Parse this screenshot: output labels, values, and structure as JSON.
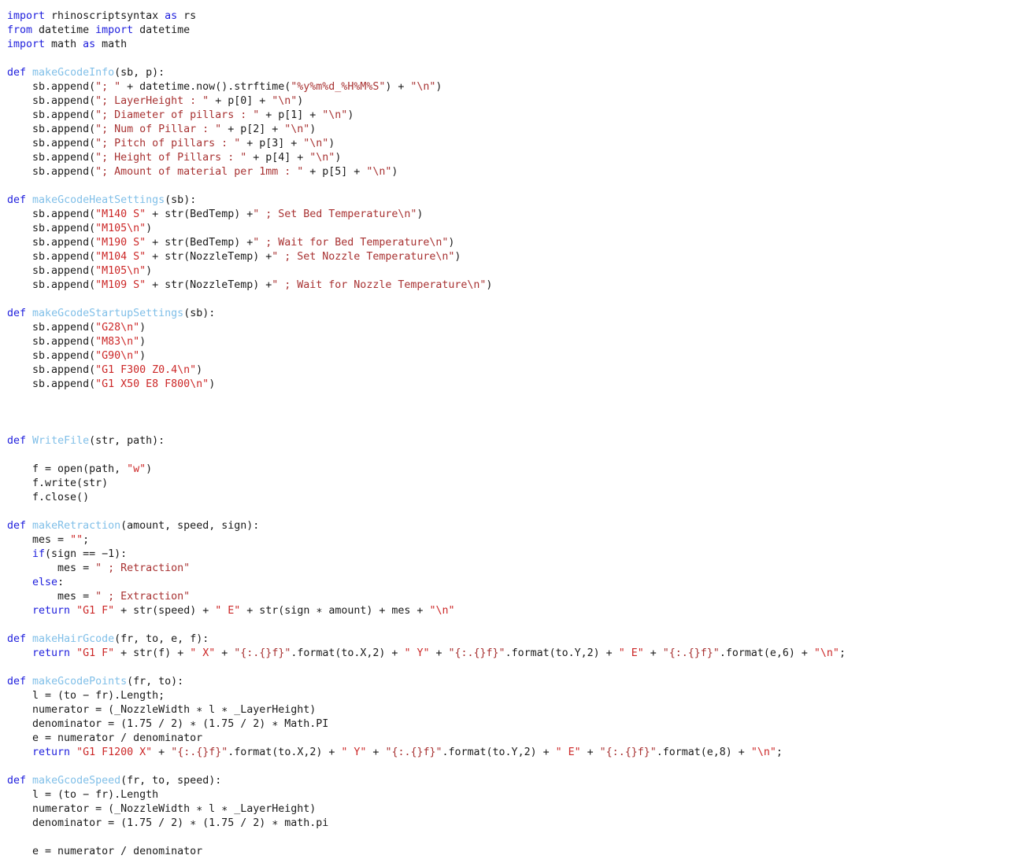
{
  "editor": {
    "language": "python",
    "background_color": "#ffffff",
    "colors": {
      "keyword": "#2020dd",
      "function_name": "#80bfe8",
      "string": "#a83232",
      "string_bright": "#cc2727",
      "plain_text": "#1a1a1a"
    }
  },
  "code": {
    "lines": [
      {
        "n": 1,
        "tokens": [
          {
            "t": "import",
            "c": "kw"
          },
          {
            "t": " rhinoscriptsyntax ",
            "c": "plain"
          },
          {
            "t": "as",
            "c": "kw"
          },
          {
            "t": " rs",
            "c": "plain"
          }
        ]
      },
      {
        "n": 2,
        "tokens": [
          {
            "t": "from",
            "c": "kw"
          },
          {
            "t": " datetime ",
            "c": "plain"
          },
          {
            "t": "import",
            "c": "kw"
          },
          {
            "t": " datetime",
            "c": "plain"
          }
        ]
      },
      {
        "n": 3,
        "tokens": [
          {
            "t": "import",
            "c": "kw"
          },
          {
            "t": " math ",
            "c": "plain"
          },
          {
            "t": "as",
            "c": "kw"
          },
          {
            "t": " math",
            "c": "plain"
          }
        ]
      },
      {
        "n": 4,
        "tokens": []
      },
      {
        "n": 5,
        "tokens": [
          {
            "t": "def",
            "c": "kw"
          },
          {
            "t": " ",
            "c": "plain"
          },
          {
            "t": "makeGcodeInfo",
            "c": "fn"
          },
          {
            "t": "(sb, p):",
            "c": "plain"
          }
        ]
      },
      {
        "n": 6,
        "tokens": [
          {
            "t": "    sb.append(",
            "c": "plain"
          },
          {
            "t": "\"; \"",
            "c": "str"
          },
          {
            "t": " + datetime.now().strftime(",
            "c": "plain"
          },
          {
            "t": "\"%y%m%d_%H%M%S\"",
            "c": "str"
          },
          {
            "t": ") + ",
            "c": "plain"
          },
          {
            "t": "\"\\n\"",
            "c": "str"
          },
          {
            "t": ")",
            "c": "plain"
          }
        ]
      },
      {
        "n": 7,
        "tokens": [
          {
            "t": "    sb.append(",
            "c": "plain"
          },
          {
            "t": "\"; LayerHeight : \"",
            "c": "str"
          },
          {
            "t": " + p[0] + ",
            "c": "plain"
          },
          {
            "t": "\"\\n\"",
            "c": "str"
          },
          {
            "t": ")",
            "c": "plain"
          }
        ]
      },
      {
        "n": 8,
        "tokens": [
          {
            "t": "    sb.append(",
            "c": "plain"
          },
          {
            "t": "\"; Diameter of pillars : \"",
            "c": "str"
          },
          {
            "t": " + p[1] + ",
            "c": "plain"
          },
          {
            "t": "\"\\n\"",
            "c": "str"
          },
          {
            "t": ")",
            "c": "plain"
          }
        ]
      },
      {
        "n": 9,
        "tokens": [
          {
            "t": "    sb.append(",
            "c": "plain"
          },
          {
            "t": "\"; Num of Pillar : \"",
            "c": "str"
          },
          {
            "t": " + p[2] + ",
            "c": "plain"
          },
          {
            "t": "\"\\n\"",
            "c": "str"
          },
          {
            "t": ")",
            "c": "plain"
          }
        ]
      },
      {
        "n": 10,
        "tokens": [
          {
            "t": "    sb.append(",
            "c": "plain"
          },
          {
            "t": "\"; Pitch of pillars : \"",
            "c": "str"
          },
          {
            "t": " + p[3] + ",
            "c": "plain"
          },
          {
            "t": "\"\\n\"",
            "c": "str"
          },
          {
            "t": ")",
            "c": "plain"
          }
        ]
      },
      {
        "n": 11,
        "tokens": [
          {
            "t": "    sb.append(",
            "c": "plain"
          },
          {
            "t": "\"; Height of Pillars : \"",
            "c": "str"
          },
          {
            "t": " + p[4] + ",
            "c": "plain"
          },
          {
            "t": "\"\\n\"",
            "c": "str"
          },
          {
            "t": ")",
            "c": "plain"
          }
        ]
      },
      {
        "n": 12,
        "tokens": [
          {
            "t": "    sb.append(",
            "c": "plain"
          },
          {
            "t": "\"; Amount of material per 1mm : \"",
            "c": "str"
          },
          {
            "t": " + p[5] + ",
            "c": "plain"
          },
          {
            "t": "\"\\n\"",
            "c": "str"
          },
          {
            "t": ")",
            "c": "plain"
          }
        ]
      },
      {
        "n": 13,
        "tokens": []
      },
      {
        "n": 14,
        "tokens": [
          {
            "t": "def",
            "c": "kw"
          },
          {
            "t": " ",
            "c": "plain"
          },
          {
            "t": "makeGcodeHeatSettings",
            "c": "fn"
          },
          {
            "t": "(sb):",
            "c": "plain"
          }
        ]
      },
      {
        "n": 15,
        "tokens": [
          {
            "t": "    sb.append(",
            "c": "plain"
          },
          {
            "t": "\"M140 S\"",
            "c": "strbr"
          },
          {
            "t": " + str(BedTemp) +",
            "c": "plain"
          },
          {
            "t": "\" ; Set Bed Temperature\\n\"",
            "c": "str"
          },
          {
            "t": ")",
            "c": "plain"
          }
        ]
      },
      {
        "n": 16,
        "tokens": [
          {
            "t": "    sb.append(",
            "c": "plain"
          },
          {
            "t": "\"M105\\n\"",
            "c": "strbr"
          },
          {
            "t": ")",
            "c": "plain"
          }
        ]
      },
      {
        "n": 17,
        "tokens": [
          {
            "t": "    sb.append(",
            "c": "plain"
          },
          {
            "t": "\"M190 S\"",
            "c": "strbr"
          },
          {
            "t": " + str(BedTemp) +",
            "c": "plain"
          },
          {
            "t": "\" ; Wait for Bed Temperature\\n\"",
            "c": "str"
          },
          {
            "t": ")",
            "c": "plain"
          }
        ]
      },
      {
        "n": 18,
        "tokens": [
          {
            "t": "    sb.append(",
            "c": "plain"
          },
          {
            "t": "\"M104 S\"",
            "c": "strbr"
          },
          {
            "t": " + str(NozzleTemp) +",
            "c": "plain"
          },
          {
            "t": "\" ; Set Nozzle Temperature\\n\"",
            "c": "str"
          },
          {
            "t": ")",
            "c": "plain"
          }
        ]
      },
      {
        "n": 19,
        "tokens": [
          {
            "t": "    sb.append(",
            "c": "plain"
          },
          {
            "t": "\"M105\\n\"",
            "c": "strbr"
          },
          {
            "t": ")",
            "c": "plain"
          }
        ]
      },
      {
        "n": 20,
        "tokens": [
          {
            "t": "    sb.append(",
            "c": "plain"
          },
          {
            "t": "\"M109 S\"",
            "c": "strbr"
          },
          {
            "t": " + str(NozzleTemp) +",
            "c": "plain"
          },
          {
            "t": "\" ; Wait for Nozzle Temperature\\n\"",
            "c": "str"
          },
          {
            "t": ")",
            "c": "plain"
          }
        ]
      },
      {
        "n": 21,
        "tokens": []
      },
      {
        "n": 22,
        "tokens": [
          {
            "t": "def",
            "c": "kw"
          },
          {
            "t": " ",
            "c": "plain"
          },
          {
            "t": "makeGcodeStartupSettings",
            "c": "fn"
          },
          {
            "t": "(sb):",
            "c": "plain"
          }
        ]
      },
      {
        "n": 23,
        "tokens": [
          {
            "t": "    sb.append(",
            "c": "plain"
          },
          {
            "t": "\"G28\\n\"",
            "c": "strbr"
          },
          {
            "t": ")",
            "c": "plain"
          }
        ]
      },
      {
        "n": 24,
        "tokens": [
          {
            "t": "    sb.append(",
            "c": "plain"
          },
          {
            "t": "\"M83\\n\"",
            "c": "strbr"
          },
          {
            "t": ")",
            "c": "plain"
          }
        ]
      },
      {
        "n": 25,
        "tokens": [
          {
            "t": "    sb.append(",
            "c": "plain"
          },
          {
            "t": "\"G90\\n\"",
            "c": "strbr"
          },
          {
            "t": ")",
            "c": "plain"
          }
        ]
      },
      {
        "n": 26,
        "tokens": [
          {
            "t": "    sb.append(",
            "c": "plain"
          },
          {
            "t": "\"G1 F300 Z0.4\\n\"",
            "c": "strbr"
          },
          {
            "t": ")",
            "c": "plain"
          }
        ]
      },
      {
        "n": 27,
        "tokens": [
          {
            "t": "    sb.append(",
            "c": "plain"
          },
          {
            "t": "\"G1 X50 E8 F800\\n\"",
            "c": "strbr"
          },
          {
            "t": ")",
            "c": "plain"
          }
        ]
      },
      {
        "n": 28,
        "tokens": []
      },
      {
        "n": 29,
        "tokens": []
      },
      {
        "n": 30,
        "tokens": []
      },
      {
        "n": 31,
        "tokens": [
          {
            "t": "def",
            "c": "kw"
          },
          {
            "t": " ",
            "c": "plain"
          },
          {
            "t": "WriteFile",
            "c": "fn"
          },
          {
            "t": "(str, path):",
            "c": "plain"
          }
        ]
      },
      {
        "n": 32,
        "tokens": []
      },
      {
        "n": 33,
        "tokens": [
          {
            "t": "    f = open(path, ",
            "c": "plain"
          },
          {
            "t": "\"w\"",
            "c": "strbr"
          },
          {
            "t": ")",
            "c": "plain"
          }
        ]
      },
      {
        "n": 34,
        "tokens": [
          {
            "t": "    f.write(str)",
            "c": "plain"
          }
        ]
      },
      {
        "n": 35,
        "tokens": [
          {
            "t": "    f.close()",
            "c": "plain"
          }
        ]
      },
      {
        "n": 36,
        "tokens": []
      },
      {
        "n": 37,
        "tokens": [
          {
            "t": "def",
            "c": "kw"
          },
          {
            "t": " ",
            "c": "plain"
          },
          {
            "t": "makeRetraction",
            "c": "fn"
          },
          {
            "t": "(amount, speed, sign):",
            "c": "plain"
          }
        ]
      },
      {
        "n": 38,
        "tokens": [
          {
            "t": "    mes = ",
            "c": "plain"
          },
          {
            "t": "\"\"",
            "c": "strbr"
          },
          {
            "t": ";",
            "c": "plain"
          }
        ]
      },
      {
        "n": 39,
        "tokens": [
          {
            "t": "    ",
            "c": "plain"
          },
          {
            "t": "if",
            "c": "kw"
          },
          {
            "t": "(sign == −1):",
            "c": "plain"
          }
        ]
      },
      {
        "n": 40,
        "tokens": [
          {
            "t": "        mes = ",
            "c": "plain"
          },
          {
            "t": "\" ; Retraction\"",
            "c": "str"
          }
        ]
      },
      {
        "n": 41,
        "tokens": [
          {
            "t": "    ",
            "c": "plain"
          },
          {
            "t": "else",
            "c": "kw"
          },
          {
            "t": ":",
            "c": "plain"
          }
        ]
      },
      {
        "n": 42,
        "tokens": [
          {
            "t": "        mes = ",
            "c": "plain"
          },
          {
            "t": "\" ; Extraction\"",
            "c": "str"
          }
        ]
      },
      {
        "n": 43,
        "tokens": [
          {
            "t": "    ",
            "c": "plain"
          },
          {
            "t": "return",
            "c": "kw"
          },
          {
            "t": " ",
            "c": "plain"
          },
          {
            "t": "\"G1 F\"",
            "c": "strbr"
          },
          {
            "t": " + str(speed) + ",
            "c": "plain"
          },
          {
            "t": "\" E\"",
            "c": "strbr"
          },
          {
            "t": " + str(sign ∗ amount) + mes + ",
            "c": "plain"
          },
          {
            "t": "\"\\n\"",
            "c": "strbr"
          }
        ]
      },
      {
        "n": 44,
        "tokens": []
      },
      {
        "n": 45,
        "tokens": [
          {
            "t": "def",
            "c": "kw"
          },
          {
            "t": " ",
            "c": "plain"
          },
          {
            "t": "makeHairGcode",
            "c": "fn"
          },
          {
            "t": "(fr, to, e, f):",
            "c": "plain"
          }
        ]
      },
      {
        "n": 46,
        "tokens": [
          {
            "t": "    ",
            "c": "plain"
          },
          {
            "t": "return",
            "c": "kw"
          },
          {
            "t": " ",
            "c": "plain"
          },
          {
            "t": "\"G1 F\"",
            "c": "strbr"
          },
          {
            "t": " + str(f) + ",
            "c": "plain"
          },
          {
            "t": "\" X\"",
            "c": "strbr"
          },
          {
            "t": " + ",
            "c": "plain"
          },
          {
            "t": "\"{:.{}f}\"",
            "c": "str"
          },
          {
            "t": ".format(to.X,2) + ",
            "c": "plain"
          },
          {
            "t": "\" Y\"",
            "c": "strbr"
          },
          {
            "t": " + ",
            "c": "plain"
          },
          {
            "t": "\"{:.{}f}\"",
            "c": "str"
          },
          {
            "t": ".format(to.Y,2) + ",
            "c": "plain"
          },
          {
            "t": "\" E\"",
            "c": "strbr"
          },
          {
            "t": " + ",
            "c": "plain"
          },
          {
            "t": "\"{:.{}f}\"",
            "c": "str"
          },
          {
            "t": ".format(e,6) + ",
            "c": "plain"
          },
          {
            "t": "\"\\n\"",
            "c": "strbr"
          },
          {
            "t": ";",
            "c": "plain"
          }
        ]
      },
      {
        "n": 47,
        "tokens": []
      },
      {
        "n": 48,
        "tokens": [
          {
            "t": "def",
            "c": "kw"
          },
          {
            "t": " ",
            "c": "plain"
          },
          {
            "t": "makeGcodePoints",
            "c": "fn"
          },
          {
            "t": "(fr, to):",
            "c": "plain"
          }
        ]
      },
      {
        "n": 49,
        "tokens": [
          {
            "t": "    l = (to − fr).Length;",
            "c": "plain"
          }
        ]
      },
      {
        "n": 50,
        "tokens": [
          {
            "t": "    numerator = (_NozzleWidth ∗ l ∗ _LayerHeight)",
            "c": "plain"
          }
        ]
      },
      {
        "n": 51,
        "tokens": [
          {
            "t": "    denominator = (1.75 / 2) ∗ (1.75 / 2) ∗ Math.PI",
            "c": "plain"
          }
        ]
      },
      {
        "n": 52,
        "tokens": [
          {
            "t": "    e = numerator / denominator",
            "c": "plain"
          }
        ]
      },
      {
        "n": 53,
        "tokens": [
          {
            "t": "    ",
            "c": "plain"
          },
          {
            "t": "return",
            "c": "kw"
          },
          {
            "t": " ",
            "c": "plain"
          },
          {
            "t": "\"G1 F1200 X\"",
            "c": "strbr"
          },
          {
            "t": " + ",
            "c": "plain"
          },
          {
            "t": "\"{:.{}f}\"",
            "c": "str"
          },
          {
            "t": ".format(to.X,2) + ",
            "c": "plain"
          },
          {
            "t": "\" Y\"",
            "c": "strbr"
          },
          {
            "t": " + ",
            "c": "plain"
          },
          {
            "t": "\"{:.{}f}\"",
            "c": "str"
          },
          {
            "t": ".format(to.Y,2) + ",
            "c": "plain"
          },
          {
            "t": "\" E\"",
            "c": "strbr"
          },
          {
            "t": " + ",
            "c": "plain"
          },
          {
            "t": "\"{:.{}f}\"",
            "c": "str"
          },
          {
            "t": ".format(e,8) + ",
            "c": "plain"
          },
          {
            "t": "\"\\n\"",
            "c": "strbr"
          },
          {
            "t": ";",
            "c": "plain"
          }
        ]
      },
      {
        "n": 54,
        "tokens": []
      },
      {
        "n": 55,
        "tokens": [
          {
            "t": "def",
            "c": "kw"
          },
          {
            "t": " ",
            "c": "plain"
          },
          {
            "t": "makeGcodeSpeed",
            "c": "fn"
          },
          {
            "t": "(fr, to, speed):",
            "c": "plain"
          }
        ]
      },
      {
        "n": 56,
        "tokens": [
          {
            "t": "    l = (to − fr).Length",
            "c": "plain"
          }
        ]
      },
      {
        "n": 57,
        "tokens": [
          {
            "t": "    numerator = (_NozzleWidth ∗ l ∗ _LayerHeight)",
            "c": "plain"
          }
        ]
      },
      {
        "n": 58,
        "tokens": [
          {
            "t": "    denominator = (1.75 / 2) ∗ (1.75 / 2) ∗ math.pi",
            "c": "plain"
          }
        ]
      },
      {
        "n": 59,
        "tokens": []
      },
      {
        "n": 60,
        "tokens": [
          {
            "t": "    e = numerator / denominator",
            "c": "plain"
          }
        ]
      }
    ]
  }
}
